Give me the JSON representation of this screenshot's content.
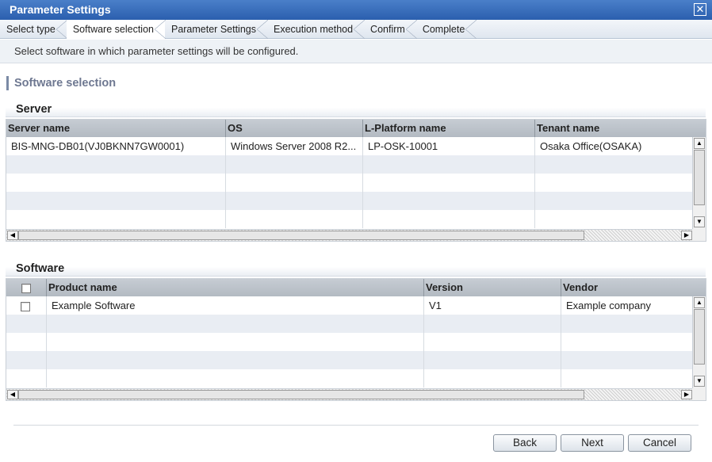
{
  "window": {
    "title": "Parameter Settings",
    "close_glyph": "✕"
  },
  "steps": [
    {
      "label": "Select type",
      "active": false
    },
    {
      "label": "Software selection",
      "active": true
    },
    {
      "label": "Parameter Settings",
      "active": false
    },
    {
      "label": "Execution method",
      "active": false
    },
    {
      "label": "Confirm",
      "active": false
    },
    {
      "label": "Complete",
      "active": false
    }
  ],
  "description": "Select software in which parameter settings will be configured.",
  "section_title": "Software selection",
  "server": {
    "title": "Server",
    "columns": [
      "Server name",
      "OS",
      "L-Platform name",
      "Tenant name"
    ],
    "rows": [
      [
        "BIS-MNG-DB01(VJ0BKNN7GW0001)",
        "Windows Server 2008 R2...",
        "LP-OSK-10001",
        "Osaka Office(OSAKA)"
      ]
    ]
  },
  "software": {
    "title": "Software",
    "columns": [
      "Product name",
      "Version",
      "Vendor"
    ],
    "rows": [
      {
        "checked": false,
        "cells": [
          "Example Software",
          "V1",
          "Example company"
        ]
      }
    ]
  },
  "scroll_icons": {
    "up": "▲",
    "down": "▼",
    "left": "◀",
    "right": "▶"
  },
  "buttons": {
    "back": "Back",
    "next": "Next",
    "cancel": "Cancel"
  }
}
